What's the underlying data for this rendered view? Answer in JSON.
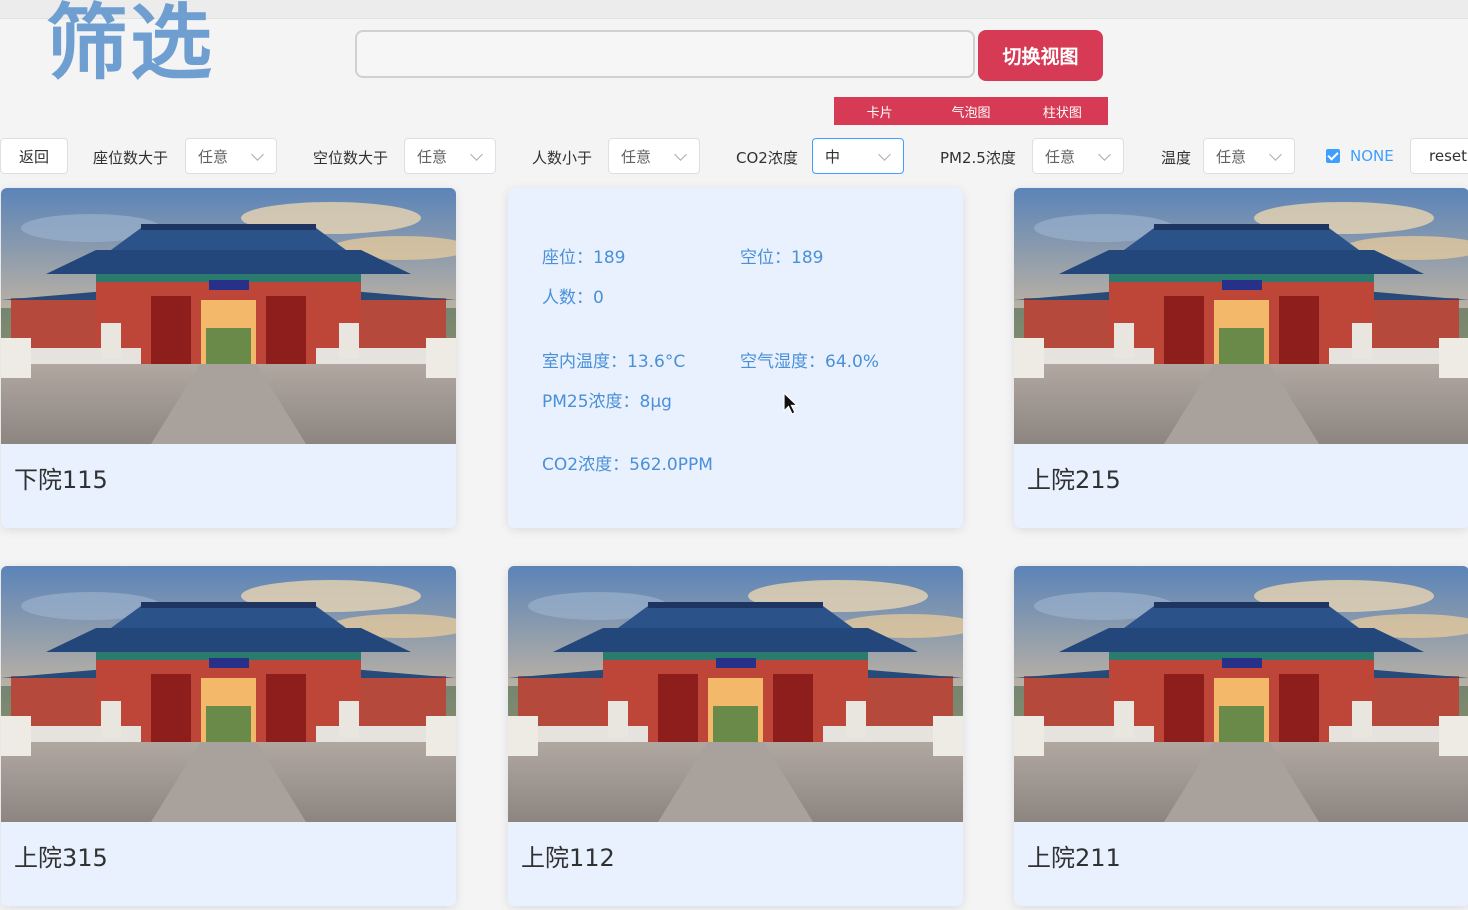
{
  "header": {
    "title": "筛选",
    "search": {
      "value": "",
      "placeholder": ""
    },
    "switch_button": "切换视图",
    "view_tabs": [
      "卡片",
      "气泡图",
      "柱状图"
    ]
  },
  "filters": {
    "back": "返回",
    "items": [
      {
        "label": "座位数大于",
        "value": "任意"
      },
      {
        "label": "空位数大于",
        "value": "任意"
      },
      {
        "label": "人数小于",
        "value": "任意"
      },
      {
        "label": "CO2浓度",
        "value": "中"
      },
      {
        "label": "PM2.5浓度",
        "value": "任意"
      },
      {
        "label": "温度",
        "value": "任意"
      }
    ],
    "checkbox": {
      "label": "NONE",
      "checked": true
    },
    "reset": "reset"
  },
  "cards": [
    {
      "title": "下院115"
    },
    {
      "title": "上院215"
    },
    {
      "title": "上院315"
    },
    {
      "title": "上院112"
    },
    {
      "title": "上院211"
    }
  ],
  "detail_card": {
    "seats": "座位：189",
    "free": "空位：189",
    "people": "人数：0",
    "indoor_temp": "室内温度：13.6°C",
    "humidity": "空气湿度：64.0%",
    "pm25": "PM25浓度：8μg",
    "co2": "CO2浓度：562.0PPM"
  }
}
